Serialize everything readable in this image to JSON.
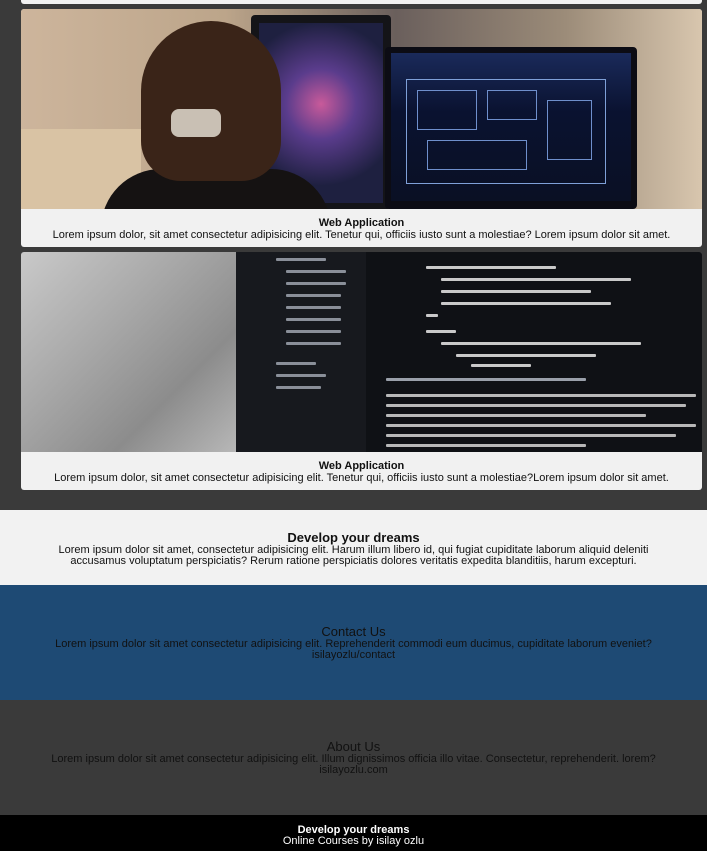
{
  "cards": [
    {
      "title": "Web Application",
      "text": "Lorem ipsum dolor, sit amet consectetur adipisicing elit. Tenetur qui, officiis iusto sunt a molestiae? Lorem ipsum dolor sit amet."
    },
    {
      "title": "Web Application",
      "text": "Lorem ipsum dolor, sit amet consectetur adipisicing elit. Tenetur qui, officiis iusto sunt a molestiae?Lorem ipsum dolor sit amet."
    }
  ],
  "dreams": {
    "title": "Develop your dreams",
    "text": "Lorem ipsum dolor sit amet, consectetur adipisicing elit. Harum illum libero id, qui fugiat cupiditate laborum aliquid deleniti accusamus voluptatum perspiciatis? Rerum ratione perspiciatis dolores veritatis expedita blanditiis, harum excepturi."
  },
  "contact": {
    "title": "Contact Us",
    "text": "Lorem ipsum dolor sit amet consectetur adipisicing elit. Reprehenderit commodi eum ducimus, cupiditate laborum eveniet?",
    "link": "isilayozlu/contact"
  },
  "about": {
    "title": "About Us",
    "text": "Lorem ipsum dolor sit amet consectetur adipisicing elit. Illum dignissimos officia illo vitae. Consectetur, reprehenderit. lorem?",
    "link": "isilayozlu.com"
  },
  "footer": {
    "line1": "Develop your dreams",
    "line2": "Online Courses by isilay ozlu"
  },
  "colors": {
    "page_bg": "#3a3a3a",
    "contact_bg": "#1e4a74",
    "footer_bg": "#000000"
  }
}
